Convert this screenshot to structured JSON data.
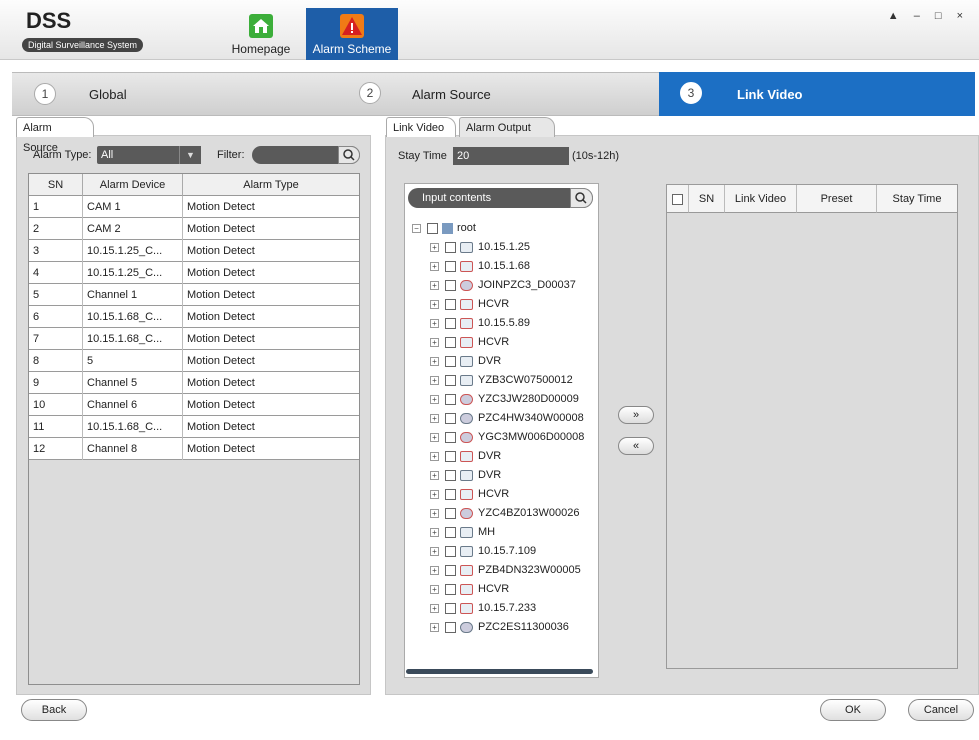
{
  "app": {
    "logo": "DSS",
    "subtitle": "Digital Surveillance System"
  },
  "nav": {
    "home_label": "Homepage",
    "alarm_label": "Alarm Scheme"
  },
  "window": {
    "controls": "▲ – □ ×"
  },
  "steps": [
    {
      "num": "1",
      "label": "Global"
    },
    {
      "num": "2",
      "label": "Alarm Source"
    },
    {
      "num": "3",
      "label": "Link Video"
    }
  ],
  "left": {
    "tab": "Alarm Source",
    "type_label": "Alarm Type:",
    "type_value": "All",
    "filter_label": "Filter:",
    "headers": [
      "SN",
      "Alarm Device",
      "Alarm Type"
    ],
    "rows": [
      [
        "1",
        "CAM 1",
        "Motion Detect"
      ],
      [
        "2",
        "CAM 2",
        "Motion Detect"
      ],
      [
        "3",
        "10.15.1.25_C...",
        "Motion Detect"
      ],
      [
        "4",
        "10.15.1.25_C...",
        "Motion Detect"
      ],
      [
        "5",
        "Channel 1",
        "Motion Detect"
      ],
      [
        "6",
        "10.15.1.68_C...",
        "Motion Detect"
      ],
      [
        "7",
        "10.15.1.68_C...",
        "Motion Detect"
      ],
      [
        "8",
        "5",
        "Motion Detect"
      ],
      [
        "9",
        "Channel 5",
        "Motion Detect"
      ],
      [
        "10",
        "Channel 6",
        "Motion Detect"
      ],
      [
        "11",
        "10.15.1.68_C...",
        "Motion Detect"
      ],
      [
        "12",
        "Channel 8",
        "Motion Detect"
      ]
    ]
  },
  "right": {
    "tabs": [
      "Link Video",
      "Alarm Output"
    ],
    "stay_label": "Stay Time",
    "stay_value": "20",
    "stay_range": "(10s-12h)",
    "search_placeholder": "Input contents",
    "tree_root": "root",
    "tree_items": [
      {
        "label": "10.15.1.25",
        "icon": "dvr"
      },
      {
        "label": "10.15.1.68",
        "icon": "dvr-red"
      },
      {
        "label": "JOINPZC3_D00037",
        "icon": "cam-red"
      },
      {
        "label": "HCVR",
        "icon": "dvr-red"
      },
      {
        "label": "10.15.5.89",
        "icon": "dvr-red"
      },
      {
        "label": "HCVR",
        "icon": "dvr-red"
      },
      {
        "label": "DVR",
        "icon": "dvr"
      },
      {
        "label": "YZB3CW07500012",
        "icon": "dvr"
      },
      {
        "label": "YZC3JW280D00009",
        "icon": "cam-red"
      },
      {
        "label": "PZC4HW340W00008",
        "icon": "cam"
      },
      {
        "label": "YGC3MW006D00008",
        "icon": "cam-red"
      },
      {
        "label": "DVR",
        "icon": "dvr-red"
      },
      {
        "label": "DVR",
        "icon": "dvr"
      },
      {
        "label": "HCVR",
        "icon": "dvr-red"
      },
      {
        "label": "YZC4BZ013W00026",
        "icon": "cam-red"
      },
      {
        "label": "MH",
        "icon": "dvr"
      },
      {
        "label": "10.15.7.109",
        "icon": "dvr"
      },
      {
        "label": "PZB4DN323W00005",
        "icon": "dvr-red"
      },
      {
        "label": "HCVR",
        "icon": "dvr-red"
      },
      {
        "label": "10.15.7.233",
        "icon": "dvr-red"
      },
      {
        "label": "PZC2ES11300036",
        "icon": "cam"
      }
    ],
    "add_btn": "»",
    "remove_btn": "«",
    "link_headers": [
      "SN",
      "Link Video",
      "Preset",
      "Stay Time"
    ]
  },
  "buttons": {
    "back": "Back",
    "ok": "OK",
    "cancel": "Cancel"
  }
}
